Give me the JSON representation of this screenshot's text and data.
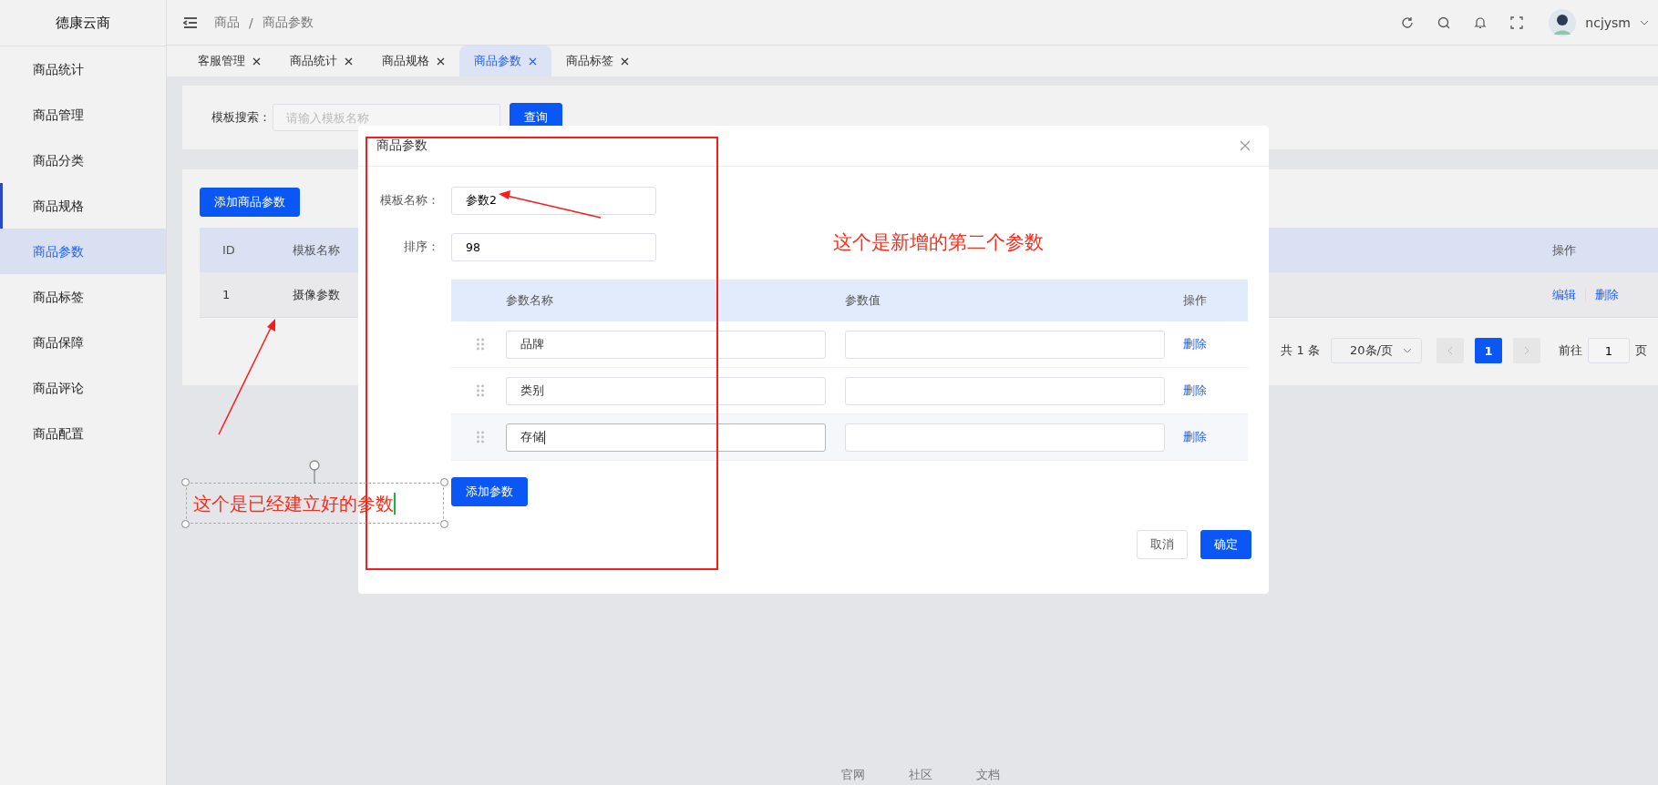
{
  "app": {
    "logo": "德康云商"
  },
  "sidebar": {
    "items": [
      {
        "label": "商品统计",
        "selected": false,
        "marked": false
      },
      {
        "label": "商品管理",
        "selected": false,
        "marked": false
      },
      {
        "label": "商品分类",
        "selected": false,
        "marked": false
      },
      {
        "label": "商品规格",
        "selected": false,
        "marked": true
      },
      {
        "label": "商品参数",
        "selected": true,
        "marked": false
      },
      {
        "label": "商品标签",
        "selected": false,
        "marked": false
      },
      {
        "label": "商品保障",
        "selected": false,
        "marked": false
      },
      {
        "label": "商品评论",
        "selected": false,
        "marked": false
      },
      {
        "label": "商品配置",
        "selected": false,
        "marked": false
      }
    ]
  },
  "header": {
    "breadcrumb": [
      "商品",
      "商品参数"
    ],
    "separator": "/",
    "user": "ncjysm"
  },
  "tabs": [
    {
      "label": "客服管理",
      "selected": false
    },
    {
      "label": "商品统计",
      "selected": false
    },
    {
      "label": "商品规格",
      "selected": false
    },
    {
      "label": "商品参数",
      "selected": true
    },
    {
      "label": "商品标签",
      "selected": false
    }
  ],
  "search": {
    "label": "模板搜索：",
    "placeholder": "请输入模板名称",
    "button": "查询"
  },
  "table": {
    "add_button": "添加商品参数",
    "columns": [
      "ID",
      "模板名称",
      "操作"
    ],
    "rows": [
      {
        "id": "1",
        "name": "摄像参数",
        "actions": [
          "编辑",
          "删除"
        ]
      }
    ]
  },
  "pagination": {
    "total": "共 1 条",
    "page_size": "20条/页",
    "pages": [
      {
        "label": "1",
        "selected": true
      }
    ],
    "goto_label": "前往",
    "goto_value": "1",
    "page_suffix": "页"
  },
  "dialog": {
    "title": "商品参数",
    "fields": [
      {
        "label": "模板名称：",
        "value": "参数2"
      },
      {
        "label": "排序：",
        "value": "98"
      }
    ],
    "params": {
      "columns": [
        "参数名称",
        "参数值",
        "操作"
      ],
      "rows": [
        {
          "name": "品牌",
          "action": "删除",
          "focused": false
        },
        {
          "name": "类别",
          "action": "删除",
          "focused": false
        },
        {
          "name": "存储",
          "action": "删除",
          "focused": true
        }
      ]
    },
    "add_button": "添加参数",
    "cancel": "取消",
    "confirm": "确定"
  },
  "annotations": [
    {
      "kind": "note",
      "text": "这个是新增的第二个参数"
    },
    {
      "kind": "textbox",
      "text": "这个是已经建立好的参数"
    }
  ],
  "footer": {
    "links": [
      "官网",
      "社区",
      "文档"
    ]
  }
}
